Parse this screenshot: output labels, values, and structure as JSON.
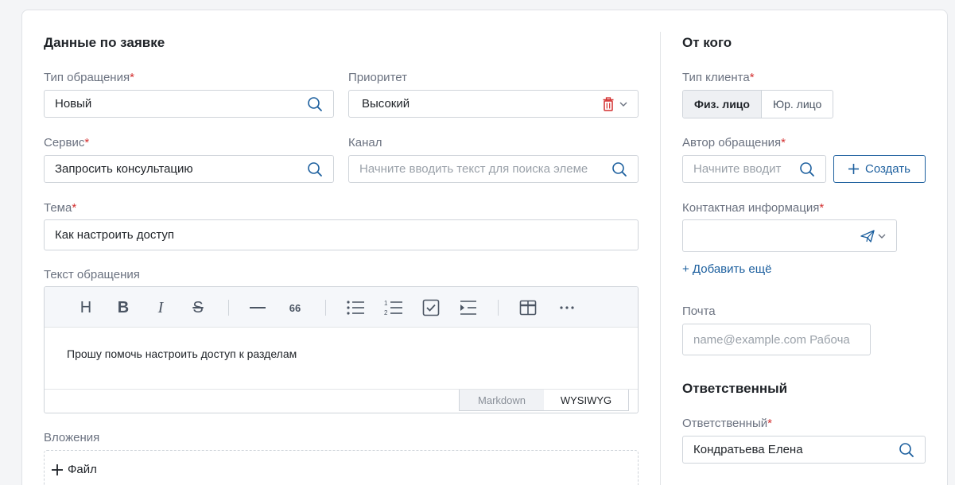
{
  "request": {
    "title": "Данные по заявке",
    "type": {
      "label": "Тип обращения",
      "required_mark": "*",
      "value": "Новый"
    },
    "priority": {
      "label": "Приоритет",
      "value": "Высокий"
    },
    "service": {
      "label": "Сервис",
      "required_mark": "*",
      "value": "Запросить консультацию"
    },
    "channel": {
      "label": "Канал",
      "placeholder": "Начните вводить текст для поиска элеме"
    },
    "subject": {
      "label": "Тема",
      "required_mark": "*",
      "value": "Как настроить доступ"
    },
    "body": {
      "label": "Текст обращения",
      "text": "Прошу помочь настроить доступ к разделам",
      "toolbar": {
        "heading": "H",
        "bold": "B",
        "italic": "I",
        "strike": "S",
        "quote": "66"
      },
      "modes": [
        "Markdown",
        "WYSIWYG"
      ],
      "active_mode": "WYSIWYG"
    },
    "attachments": {
      "label": "Вложения",
      "add_file": "Файл"
    }
  },
  "from": {
    "title": "От кого",
    "client_type": {
      "label": "Тип клиента",
      "required_mark": "*",
      "options": [
        "Физ. лицо",
        "Юр. лицо"
      ],
      "selected": "Физ. лицо"
    },
    "author": {
      "label": "Автор обращения",
      "required_mark": "*",
      "placeholder": "Начните вводит",
      "create_label": "Создать"
    },
    "contact": {
      "label": "Контактная информация",
      "required_mark": "*",
      "value": ""
    },
    "add_more": "+ Добавить ещё",
    "email": {
      "label": "Почта",
      "placeholder": "name@example.com Рабоча"
    }
  },
  "assignee": {
    "title": "Ответственный",
    "field": {
      "label": "Ответственный",
      "required_mark": "*",
      "value": "Кондратьева Елена"
    }
  },
  "colors": {
    "accent": "#1c5f9e",
    "required": "#d32f2f",
    "delete": "#d32f2f"
  },
  "icons": [
    "search-icon",
    "trash-icon",
    "chevron-down-icon",
    "send-icon",
    "plus-icon"
  ]
}
